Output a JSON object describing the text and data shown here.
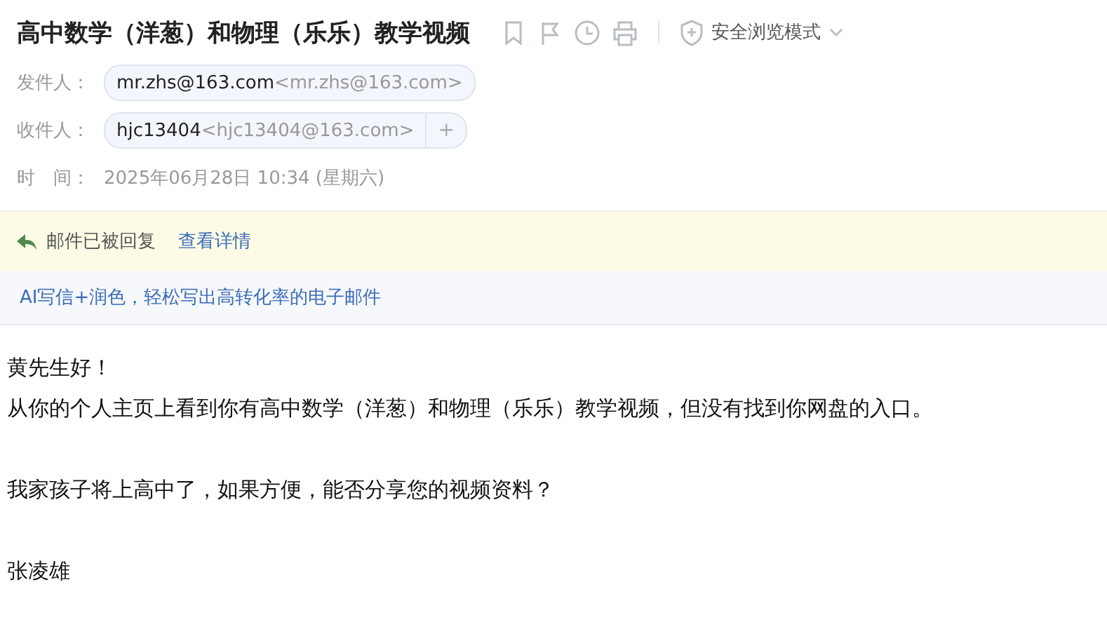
{
  "subject": "高中数学（洋葱）和物理（乐乐）教学视频",
  "toolbar": {
    "safe_mode": "安全浏览模式"
  },
  "header": [
    {
      "kind": "contact",
      "label": "发件人：",
      "name": "mr.zhs@163.com",
      "address": "<mr.zhs@163.com>"
    },
    {
      "kind": "contact",
      "label": "收件人：",
      "name": "hjc13404",
      "address": "<hjc13404@163.com>",
      "add": "+"
    },
    {
      "kind": "text",
      "label": "时　间：",
      "value": "2025年06月28日 10:34 (星期六)"
    }
  ],
  "notice": {
    "text": "邮件已被回复",
    "link": "查看详情"
  },
  "promo": "AI写信+润色，轻松写出高转化率的电子邮件",
  "body": [
    [
      "黄先生好！",
      "从你的个人主页上看到你有高中数学（洋葱）和物理（乐乐）教学视频，但没有找到你网盘的入口。"
    ],
    [
      "我家孩子将上高中了，如果方便，能否分享您的视频资料？"
    ],
    [
      "张凌雄"
    ]
  ]
}
